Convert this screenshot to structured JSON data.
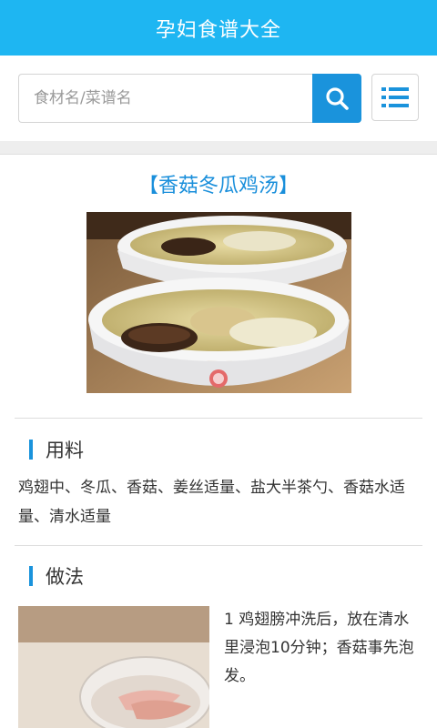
{
  "header": {
    "title": "孕妇食谱大全"
  },
  "search": {
    "placeholder": "食材名/菜谱名",
    "value": ""
  },
  "icons": {
    "search": "search-icon",
    "menu": "list-menu-icon"
  },
  "recipe": {
    "title": "【香菇冬瓜鸡汤】",
    "photo": "chicken-soup-bowls-photo",
    "ingredients_heading": "用料",
    "ingredients": "鸡翅中、冬瓜、香菇、姜丝适量、盐大半茶勺、香菇水适量、清水适量",
    "method_heading": "做法",
    "steps": [
      {
        "text": "1 鸡翅膀冲洗后，放在清水里浸泡10分钟；香菇事先泡发。",
        "photo": "chicken-wings-bowl-photo"
      }
    ]
  },
  "colors": {
    "header": "#1eb6f2",
    "accent": "#1a93dc",
    "title": "#1a8fdb"
  }
}
